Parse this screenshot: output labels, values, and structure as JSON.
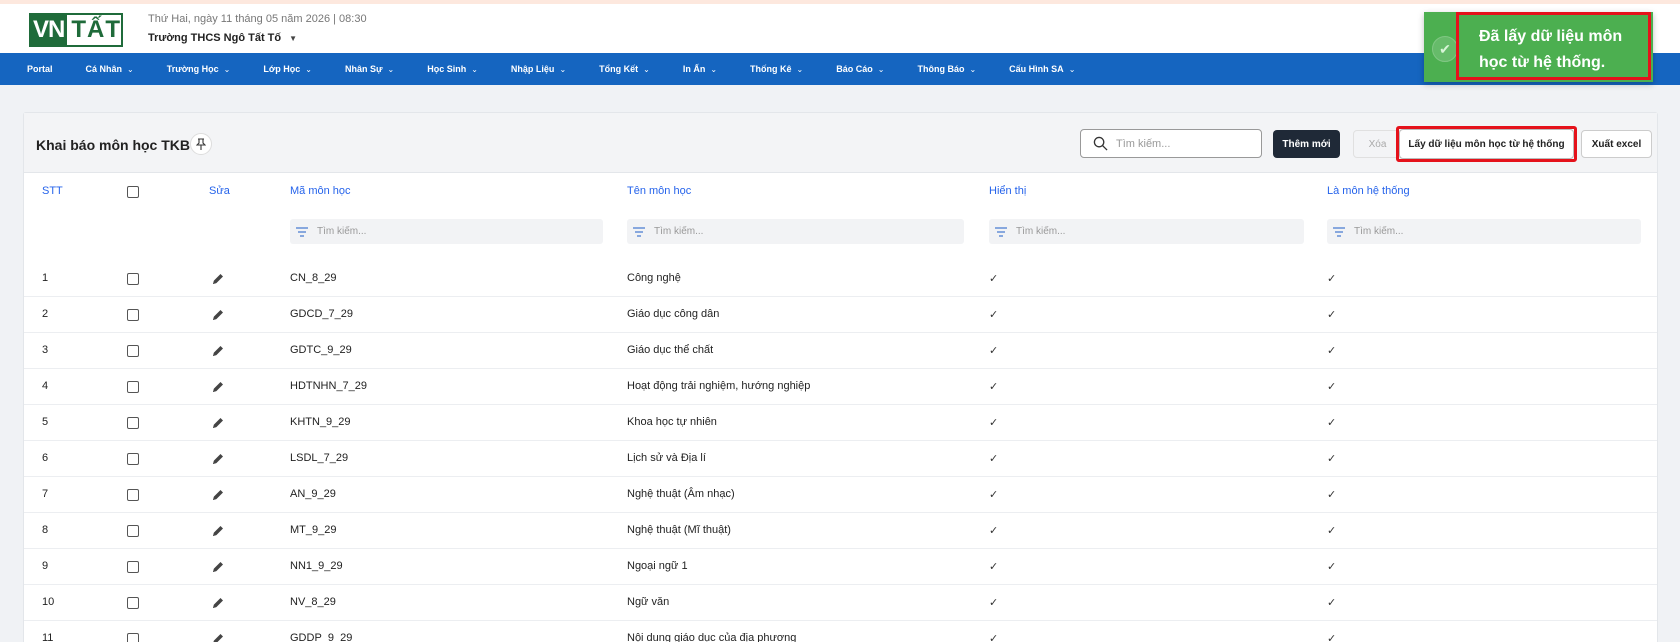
{
  "header": {
    "logo_vn": "VN",
    "logo_tat": "TẤT",
    "date": "Thứ Hai, ngày 11 tháng 05 năm 2026 | 08:30",
    "school": "Trường THCS Ngô Tất Tố"
  },
  "nav": [
    {
      "label": "Portal",
      "has_menu": false
    },
    {
      "label": "Cá Nhân",
      "has_menu": true
    },
    {
      "label": "Trường Học",
      "has_menu": true
    },
    {
      "label": "Lớp Học",
      "has_menu": true
    },
    {
      "label": "Nhân Sự",
      "has_menu": true
    },
    {
      "label": "Học Sinh",
      "has_menu": true
    },
    {
      "label": "Nhập Liệu",
      "has_menu": true
    },
    {
      "label": "Tổng Kết",
      "has_menu": true
    },
    {
      "label": "In Ấn",
      "has_menu": true
    },
    {
      "label": "Thống Kê",
      "has_menu": true
    },
    {
      "label": "Báo Cáo",
      "has_menu": true
    },
    {
      "label": "Thông Báo",
      "has_menu": true
    },
    {
      "label": "Cấu Hình SA",
      "has_menu": true
    }
  ],
  "toast": {
    "message": "Đã lấy dữ liệu môn học từ hệ thống.",
    "icon": "check-circle-icon",
    "color": "#4caf50"
  },
  "page": {
    "title": "Khai báo môn học TKB",
    "search_placeholder": "Tìm kiếm...",
    "btn_new": "Thêm mới",
    "btn_delete": "Xóa",
    "btn_fetch": "Lấy dữ liệu môn học từ hệ thống",
    "btn_excel": "Xuất excel"
  },
  "table": {
    "columns": {
      "stt": "STT",
      "edit": "Sửa",
      "code": "Mã môn học",
      "name": "Tên môn học",
      "visible": "Hiển thị",
      "system": "Là môn hệ thống"
    },
    "filter_placeholder": "Tìm kiếm...",
    "rows": [
      {
        "stt": "1",
        "code": "CN_8_29",
        "name": "Công nghệ",
        "visible": "✓",
        "system": "✓"
      },
      {
        "stt": "2",
        "code": "GDCD_7_29",
        "name": "Giáo dục công dân",
        "visible": "✓",
        "system": "✓"
      },
      {
        "stt": "3",
        "code": "GDTC_9_29",
        "name": "Giáo dục thể chất",
        "visible": "✓",
        "system": "✓"
      },
      {
        "stt": "4",
        "code": "HDTNHN_7_29",
        "name": "Hoạt động trải nghiệm, hướng nghiệp",
        "visible": "✓",
        "system": "✓"
      },
      {
        "stt": "5",
        "code": "KHTN_9_29",
        "name": "Khoa học tự nhiên",
        "visible": "✓",
        "system": "✓"
      },
      {
        "stt": "6",
        "code": "LSDL_7_29",
        "name": "Lịch sử và Địa lí",
        "visible": "✓",
        "system": "✓"
      },
      {
        "stt": "7",
        "code": "AN_9_29",
        "name": "Nghệ thuật (Âm nhạc)",
        "visible": "✓",
        "system": "✓"
      },
      {
        "stt": "8",
        "code": "MT_9_29",
        "name": "Nghệ thuật (Mĩ thuật)",
        "visible": "✓",
        "system": "✓"
      },
      {
        "stt": "9",
        "code": "NN1_9_29",
        "name": "Ngoại ngữ 1",
        "visible": "✓",
        "system": "✓"
      },
      {
        "stt": "10",
        "code": "NV_8_29",
        "name": "Ngữ văn",
        "visible": "✓",
        "system": "✓"
      },
      {
        "stt": "11",
        "code": "GDDP_9_29",
        "name": "Nội dung giáo dục của địa phương",
        "visible": "✓",
        "system": "✓"
      }
    ]
  },
  "colors": {
    "nav_bg": "#1565c0",
    "header_link": "#2563eb",
    "highlight": "#e5121b",
    "btn_dark": "#1f2937"
  }
}
